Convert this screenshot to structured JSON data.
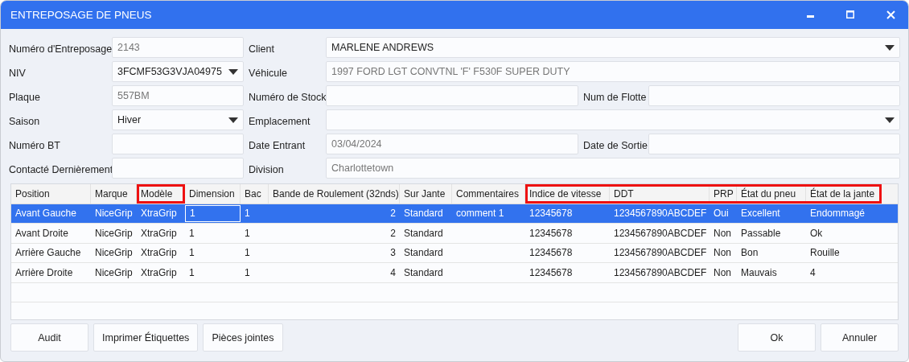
{
  "window": {
    "title": "ENTREPOSAGE DE PNEUS"
  },
  "form": {
    "rows": [
      {
        "fields": [
          {
            "label": "Numéro d'Entreposage",
            "kind": "text",
            "value": "2143",
            "readonly": true
          },
          {
            "label": "Client",
            "kind": "dropdown",
            "value": "MARLENE ANDREWS",
            "readonly": false
          }
        ]
      },
      {
        "fields": [
          {
            "label": "NIV",
            "kind": "dropdown",
            "value": "3FCMF53G3VJA04975",
            "readonly": false
          },
          {
            "label": "Véhicule",
            "kind": "text",
            "value": "1997 FORD LGT CONVTNL 'F' F530F SUPER DUTY",
            "readonly": true
          }
        ]
      },
      {
        "fields": [
          {
            "label": "Plaque",
            "kind": "text",
            "value": "557BM",
            "readonly": true
          },
          {
            "label": "Numéro de Stock",
            "kind": "text"
          },
          {
            "label": "Num de Flotte",
            "kind": "text"
          }
        ]
      },
      {
        "fields": [
          {
            "label": "Saison",
            "kind": "dropdown",
            "value": "Hiver",
            "readonly": false
          },
          {
            "label": "Emplacement",
            "kind": "dropdown"
          }
        ]
      },
      {
        "fields": [
          {
            "label": "Numéro BT",
            "kind": "text"
          },
          {
            "label": "Date Entrant",
            "kind": "text",
            "value": "03/04/2024",
            "readonly": true
          },
          {
            "label": "Date de Sortie",
            "kind": "text"
          }
        ]
      },
      {
        "fields": [
          {
            "label": "Contacté Dernièrement",
            "kind": "text"
          },
          {
            "label": "Division",
            "kind": "text",
            "value": "Charlottetown",
            "readonly": true
          }
        ]
      }
    ]
  },
  "table": {
    "columns": [
      {
        "label": "Position",
        "kind": "text",
        "highlighted": false
      },
      {
        "label": "Marque",
        "kind": "text",
        "highlighted": false
      },
      {
        "label": "Modèle",
        "kind": "text",
        "highlighted": true
      },
      {
        "label": "Dimension",
        "kind": "text",
        "highlighted": false
      },
      {
        "label": "Bac",
        "kind": "text",
        "highlighted": false
      },
      {
        "label": "Bande de Roulement (32nds)",
        "kind": "number",
        "highlighted": false
      },
      {
        "label": "Sur Jante",
        "kind": "text",
        "highlighted": false
      },
      {
        "label": "Commentaires",
        "kind": "text",
        "highlighted": false
      },
      {
        "label": "Indice de vitesse",
        "kind": "text",
        "highlighted": true
      },
      {
        "label": "DDT",
        "kind": "text",
        "highlighted": true
      },
      {
        "label": "PRP",
        "kind": "text",
        "highlighted": true
      },
      {
        "label": "État du pneu",
        "kind": "text",
        "highlighted": true
      },
      {
        "label": "État de la jante",
        "kind": "text",
        "highlighted": true
      }
    ],
    "rows": [
      {
        "selected": true,
        "cells": [
          {
            "text": "Avant Gauche",
            "editing": false
          },
          {
            "text": "NiceGrip",
            "editing": false
          },
          {
            "text": "XtraGrip",
            "editing": false
          },
          {
            "text": "1",
            "editing": true
          },
          {
            "text": "1",
            "editing": false
          },
          {
            "text": "2",
            "editing": false
          },
          {
            "text": "Standard",
            "editing": false
          },
          {
            "text": "comment 1",
            "editing": false
          },
          {
            "text": "12345678",
            "editing": false
          },
          {
            "text": "1234567890ABCDEF",
            "editing": false
          },
          {
            "text": "Oui",
            "editing": false
          },
          {
            "text": "Excellent",
            "editing": false
          },
          {
            "text": "Endommagé",
            "editing": false
          }
        ]
      },
      {
        "selected": false,
        "cells": [
          {
            "text": "Avant Droite",
            "editing": false
          },
          {
            "text": "NiceGrip",
            "editing": false
          },
          {
            "text": "XtraGrip",
            "editing": false
          },
          {
            "text": "1",
            "editing": false
          },
          {
            "text": "1",
            "editing": false
          },
          {
            "text": "2",
            "editing": false
          },
          {
            "text": "Standard",
            "editing": false
          },
          {
            "text": "",
            "editing": false
          },
          {
            "text": "12345678",
            "editing": false
          },
          {
            "text": "1234567890ABCDEF",
            "editing": false
          },
          {
            "text": "Non",
            "editing": false
          },
          {
            "text": "Passable",
            "editing": false
          },
          {
            "text": "Ok",
            "editing": false
          }
        ]
      },
      {
        "selected": false,
        "cells": [
          {
            "text": "Arrière Gauche",
            "editing": false
          },
          {
            "text": "NiceGrip",
            "editing": false
          },
          {
            "text": "XtraGrip",
            "editing": false
          },
          {
            "text": "1",
            "editing": false
          },
          {
            "text": "1",
            "editing": false
          },
          {
            "text": "3",
            "editing": false
          },
          {
            "text": "Standard",
            "editing": false
          },
          {
            "text": "",
            "editing": false
          },
          {
            "text": "12345678",
            "editing": false
          },
          {
            "text": "1234567890ABCDEF",
            "editing": false
          },
          {
            "text": "Non",
            "editing": false
          },
          {
            "text": "Bon",
            "editing": false
          },
          {
            "text": "Rouille",
            "editing": false
          }
        ]
      },
      {
        "selected": false,
        "cells": [
          {
            "text": "Arrière Droite",
            "editing": false
          },
          {
            "text": "NiceGrip",
            "editing": false
          },
          {
            "text": "XtraGrip",
            "editing": false
          },
          {
            "text": "1",
            "editing": false
          },
          {
            "text": "1",
            "editing": false
          },
          {
            "text": "4",
            "editing": false
          },
          {
            "text": "Standard",
            "editing": false
          },
          {
            "text": "",
            "editing": false
          },
          {
            "text": "12345678",
            "editing": false
          },
          {
            "text": "1234567890ABCDEF",
            "editing": false
          },
          {
            "text": "Non",
            "editing": false
          },
          {
            "text": "Mauvais",
            "editing": false
          },
          {
            "text": "4",
            "editing": false
          }
        ]
      }
    ]
  },
  "buttons_left": [
    "Audit",
    "Imprimer Étiquettes",
    "Pièces jointes"
  ],
  "buttons_right": [
    "Ok",
    "Annuler"
  ]
}
